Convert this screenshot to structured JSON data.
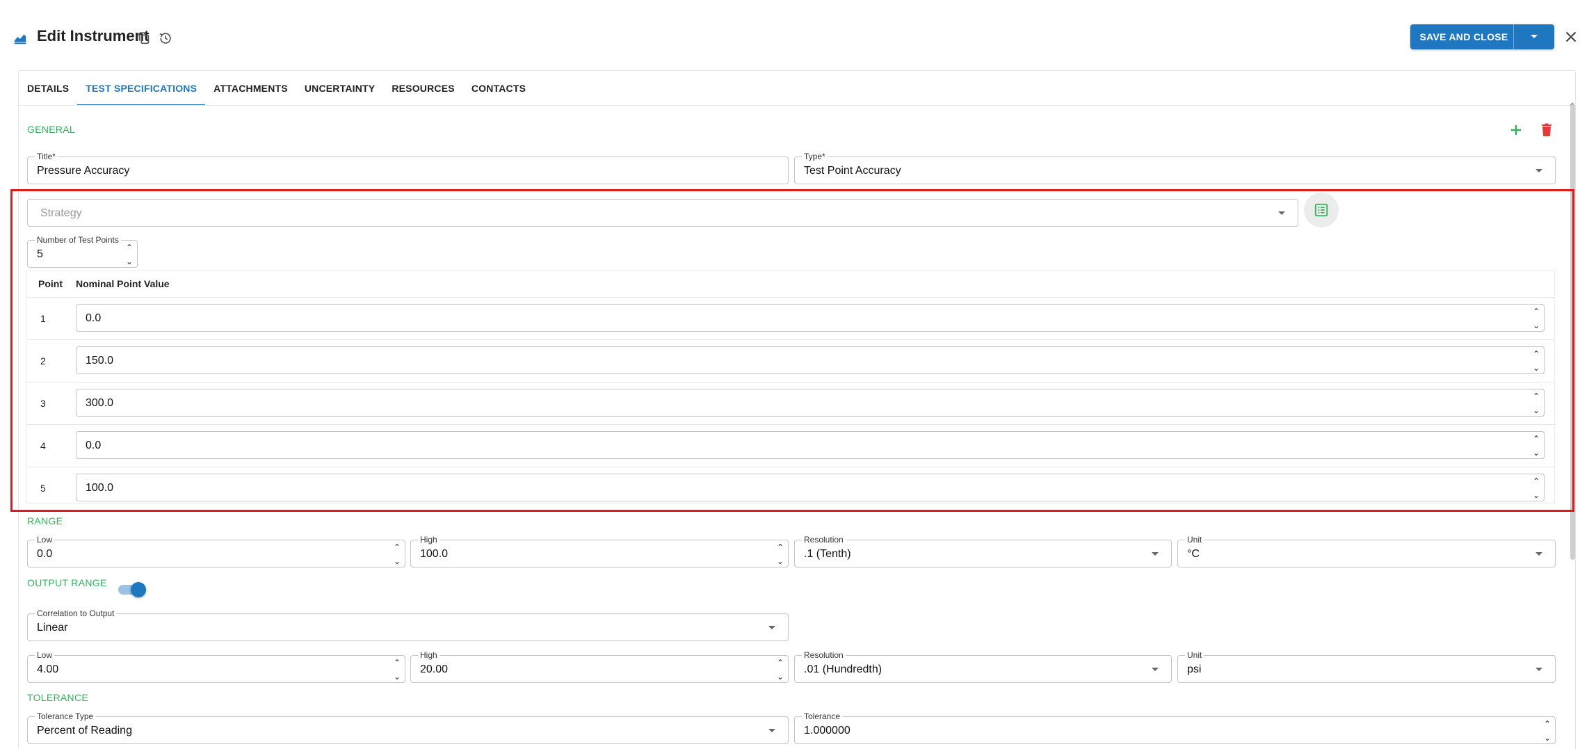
{
  "header": {
    "title": "Edit Instrument",
    "save_label": "SAVE AND CLOSE"
  },
  "tabs": [
    "DETAILS",
    "TEST SPECIFICATIONS",
    "ATTACHMENTS",
    "UNCERTAINTY",
    "RESOURCES",
    "CONTACTS"
  ],
  "active_tab": "TEST SPECIFICATIONS",
  "general": {
    "section_label": "GENERAL",
    "title_label": "Title*",
    "title_value": "Pressure Accuracy",
    "type_label": "Type*",
    "type_value": "Test Point Accuracy",
    "strategy_placeholder": "Strategy",
    "num_points_label": "Number of Test Points",
    "num_points_value": "5"
  },
  "points_table": {
    "col_point": "Point",
    "col_nominal": "Nominal Point Value",
    "rows": [
      {
        "point": "1",
        "value": "0.0"
      },
      {
        "point": "2",
        "value": "150.0"
      },
      {
        "point": "3",
        "value": "300.0"
      },
      {
        "point": "4",
        "value": "0.0"
      },
      {
        "point": "5",
        "value": "100.0"
      }
    ]
  },
  "range": {
    "section_label": "RANGE",
    "low_label": "Low",
    "low_value": "0.0",
    "high_label": "High",
    "high_value": "100.0",
    "resolution_label": "Resolution",
    "resolution_value": ".1 (Tenth)",
    "unit_label": "Unit",
    "unit_value": "°C"
  },
  "output_range": {
    "section_label": "OUTPUT RANGE",
    "enabled": true,
    "correlation_label": "Correlation to Output",
    "correlation_value": "Linear",
    "low_label": "Low",
    "low_value": "4.00",
    "high_label": "High",
    "high_value": "20.00",
    "resolution_label": "Resolution",
    "resolution_value": ".01 (Hundredth)",
    "unit_label": "Unit",
    "unit_value": "psi"
  },
  "tolerance": {
    "section_label": "TOLERANCE",
    "type_label": "Tolerance Type",
    "type_value": "Percent of Reading",
    "tolerance_label": "Tolerance",
    "tolerance_value": "1.000000"
  },
  "colors": {
    "accent": "#1f77c0",
    "section_green": "#2fb45a",
    "delete_red": "#e53935",
    "highlight_red": "#e01b1b"
  }
}
